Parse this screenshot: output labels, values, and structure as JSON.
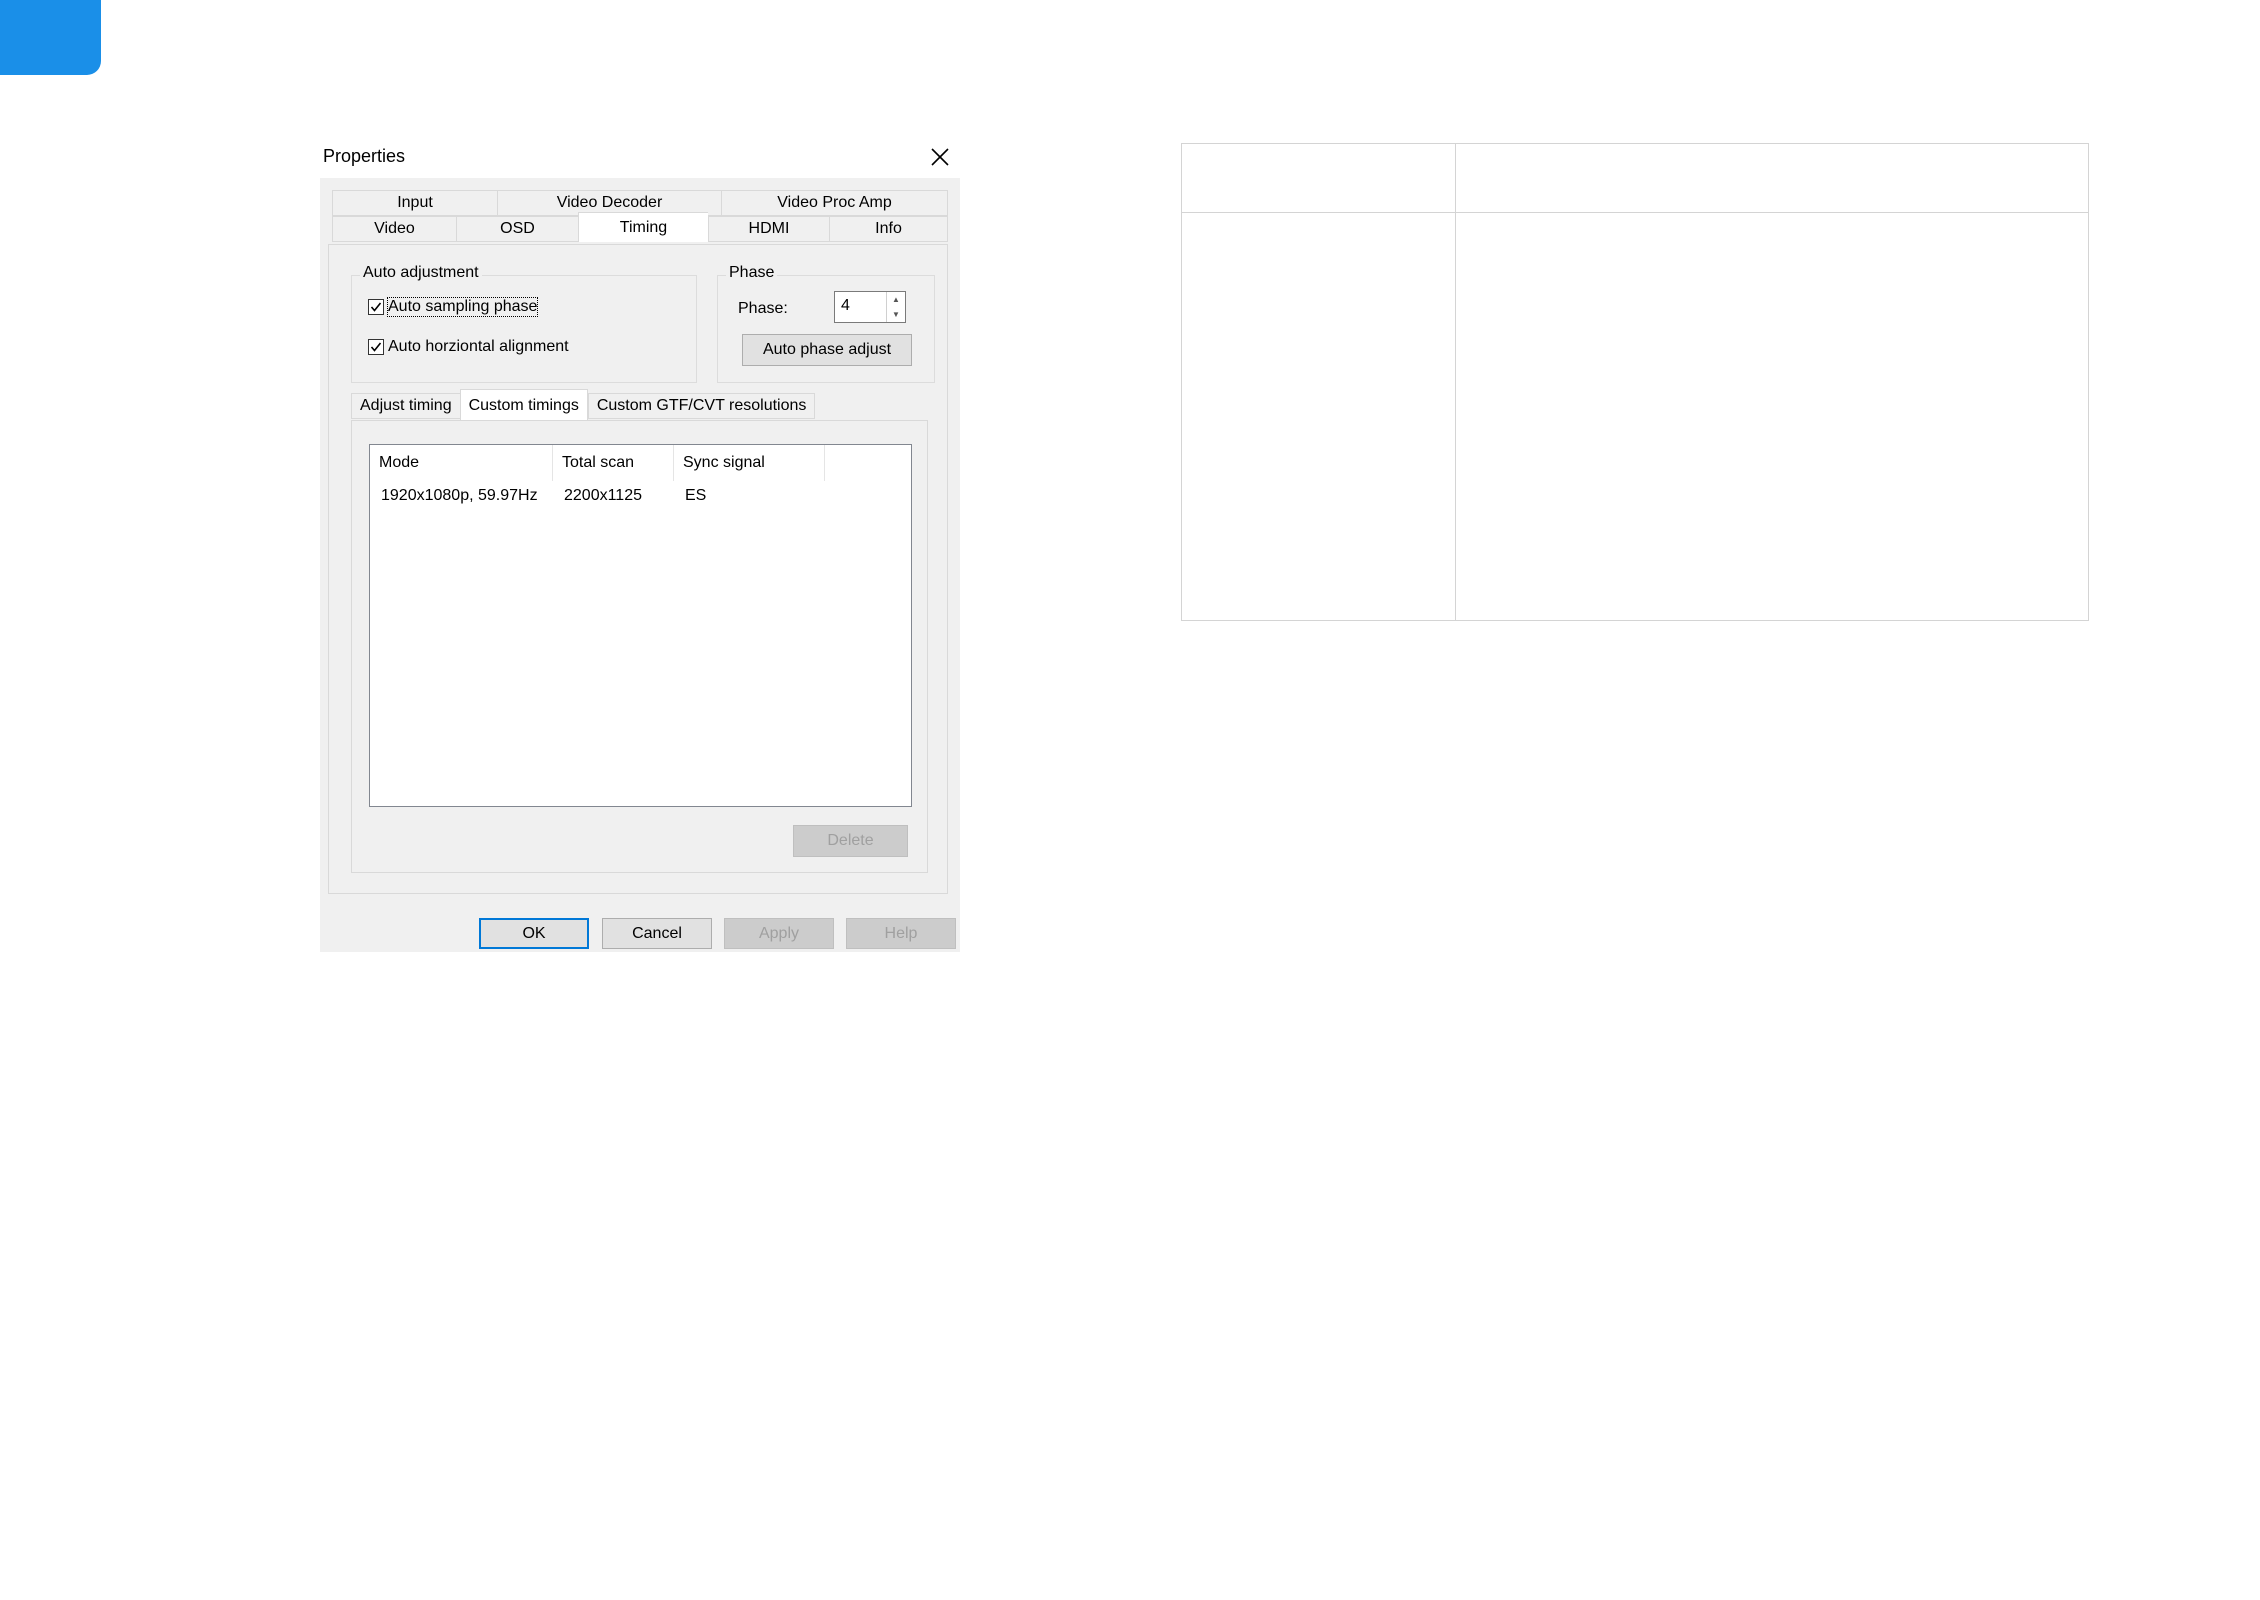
{
  "window": {
    "title": "Properties",
    "close_icon": "close-icon"
  },
  "tabs": {
    "row1": [
      "Input",
      "Video Decoder",
      "Video Proc Amp"
    ],
    "row2": [
      "Video",
      "OSD",
      "Timing",
      "HDMI",
      "Info"
    ],
    "active": "Timing"
  },
  "auto_adjustment": {
    "label": "Auto adjustment",
    "sampling_phase": {
      "label": "Auto sampling phase",
      "checked": true
    },
    "horizontal_alignment": {
      "label": "Auto horziontal alignment",
      "checked": true
    }
  },
  "phase": {
    "group_label": "Phase",
    "field_label": "Phase:",
    "value": "4",
    "auto_button": "Auto phase adjust"
  },
  "subtabs": {
    "items": [
      "Adjust timing",
      "Custom timings",
      "Custom GTF/CVT resolutions"
    ],
    "active": "Custom timings"
  },
  "custom_timings": {
    "columns": [
      "Mode",
      "Total scan",
      "Sync signal"
    ],
    "rows": [
      {
        "mode": "1920x1080p, 59.97Hz",
        "total_scan": "2200x1125",
        "sync_signal": "ES"
      }
    ],
    "delete_button": "Delete"
  },
  "footer": {
    "ok": "OK",
    "cancel": "Cancel",
    "apply": "Apply",
    "help": "Help"
  },
  "colors": {
    "accent": "#1a8fe8",
    "focus_border": "#0078d7"
  }
}
